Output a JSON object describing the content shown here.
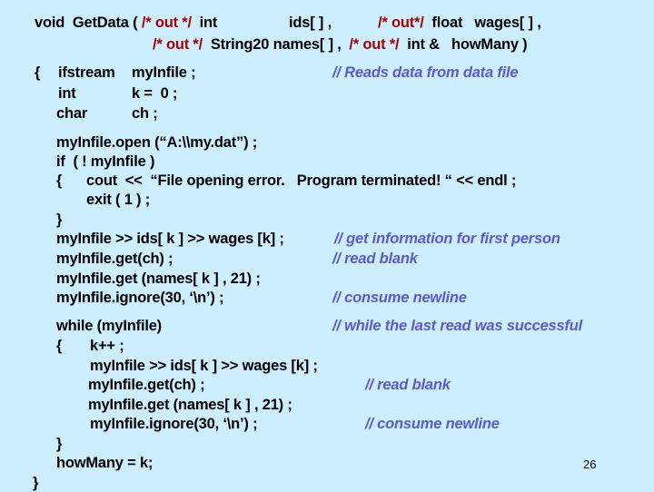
{
  "signature": {
    "line1": {
      "prefix": "void  GetData ( ",
      "out1": "/* out */",
      "type1": "  int",
      "param1": "ids[ ] ,",
      "out2": "/* out*/",
      "type2": "  float   wages[ ] ,"
    },
    "line2": {
      "out3": "/* out */",
      "type3": "  String20 names[ ] ,  ",
      "out4": "/* out */",
      "type4": "  int &   howMany )"
    }
  },
  "decls": {
    "open_brace": "{",
    "line1_kw": "ifstream",
    "line1_var": "myInfile ;",
    "line1_comment": "// Reads data from data file",
    "line2_kw": "int",
    "line2_var": "k =  0 ;",
    "line3_kw": "char",
    "line3_var": "ch ;"
  },
  "body": {
    "open_file": "myInfile.open (“A:\\\\my.dat”) ;",
    "if_check": "if  ( ! myInfile )",
    "error_open": "{",
    "error_cout": "cout  <<  “File opening error.   Program terminated! “ << endl ;",
    "error_exit": "exit ( 1 ) ;",
    "error_close": "}",
    "read1": "myInfile >> ids[ k ] >> wages [k] ;",
    "read1_comment": "// get information for first person",
    "get1": "myInfile.get(ch) ;",
    "get1_comment": "// read blank",
    "getname1": "myInfile.get (names[ k ] , 21) ;",
    "ignore1": "myInfile.ignore(30, ‘\\n’) ;",
    "ignore1_comment": "// consume newline"
  },
  "loop": {
    "while": "while (myInfile)",
    "while_comment": "// while the last read was successful",
    "open_brace": "{",
    "increment": "k++ ;",
    "read": "myInfile >> ids[ k ] >> wages [k] ;",
    "get": "myInfile.get(ch) ;",
    "get_comment": "// read blank",
    "getname": "myInfile.get (names[ k ] , 21) ;",
    "ignore": "myInfile.ignore(30, ‘\\n’) ;",
    "ignore_comment": "// consume newline",
    "close_brace": "}"
  },
  "assign": "howMany = k;",
  "final_brace": "}",
  "page_number": "26",
  "colors": {
    "background": "#cceeff",
    "code": "#000000",
    "out_annotation": "#aa0000",
    "comment": "#5a5acc"
  }
}
